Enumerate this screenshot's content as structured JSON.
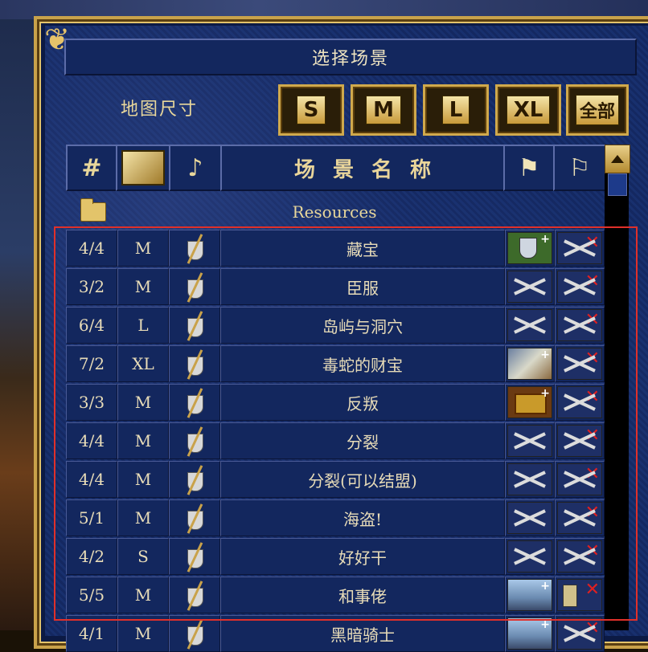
{
  "title": "选择场景",
  "map_size_label": "地图尺寸",
  "size_buttons": [
    "S",
    "M",
    "L",
    "XL",
    "全部"
  ],
  "header": {
    "name": "场景名称",
    "hash": "#"
  },
  "folder": {
    "label": "Resources"
  },
  "rows": [
    {
      "players": "4/4",
      "size": "M",
      "name": "藏宝",
      "victory": "shield",
      "loss": "x"
    },
    {
      "players": "3/2",
      "size": "M",
      "name": "臣服",
      "victory": "cross",
      "loss": "x"
    },
    {
      "players": "6/4",
      "size": "L",
      "name": "岛屿与洞穴",
      "victory": "cross",
      "loss": "x"
    },
    {
      "players": "7/2",
      "size": "XL",
      "name": "毒蛇的财宝",
      "victory": "dragon",
      "loss": "x"
    },
    {
      "players": "3/3",
      "size": "M",
      "name": "反叛",
      "victory": "chest",
      "loss": "x"
    },
    {
      "players": "4/4",
      "size": "M",
      "name": "分裂",
      "victory": "cross",
      "loss": "x"
    },
    {
      "players": "4/4",
      "size": "M",
      "name": "分裂(可以结盟)",
      "victory": "cross",
      "loss": "x"
    },
    {
      "players": "5/1",
      "size": "M",
      "name": "海盗!",
      "victory": "cross",
      "loss": "x"
    },
    {
      "players": "4/2",
      "size": "S",
      "name": "好好干",
      "victory": "cross",
      "loss": "x"
    },
    {
      "players": "5/5",
      "size": "M",
      "name": "和事佬",
      "victory": "city",
      "loss": "hourglass"
    },
    {
      "players": "4/1",
      "size": "M",
      "name": "黑暗骑士",
      "victory": "city",
      "loss": "x"
    }
  ],
  "colors": {
    "highlight": "#e0302a",
    "gold": "#c9a24a",
    "panel": "#13275e"
  }
}
